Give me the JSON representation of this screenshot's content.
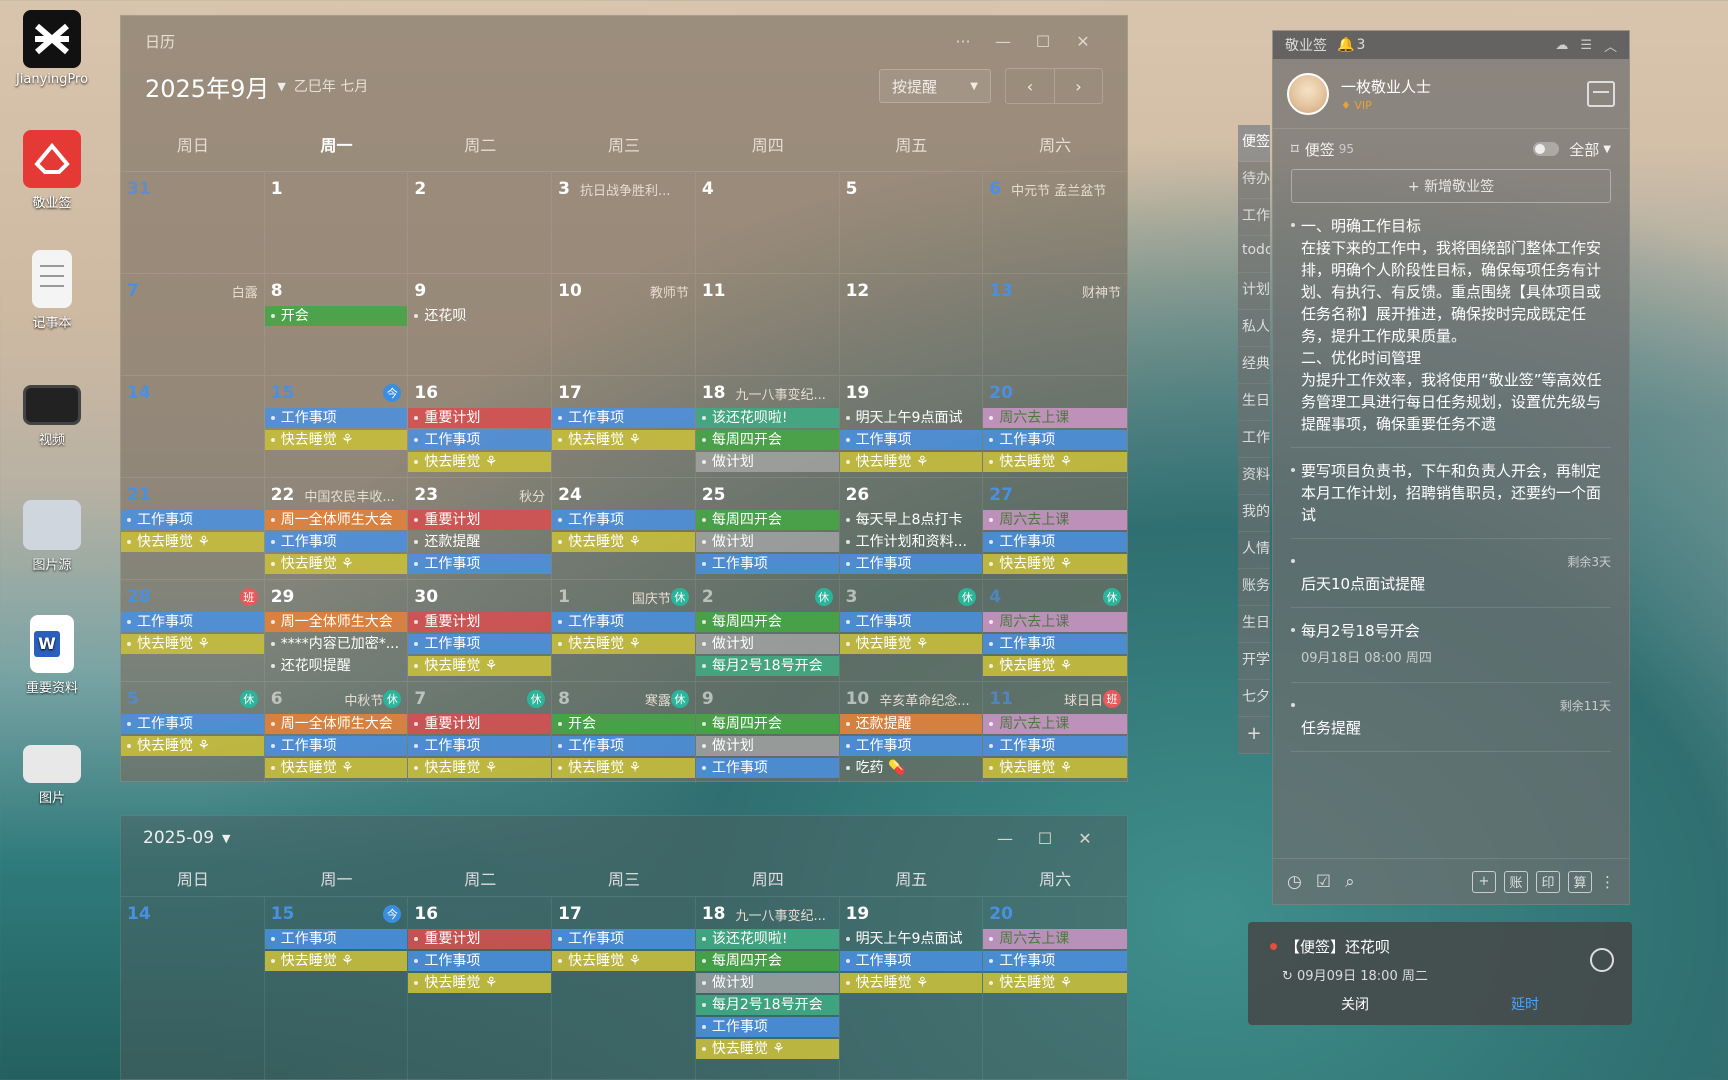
{
  "desktop": {
    "icons": [
      {
        "label": "JianyingPro"
      },
      {
        "label": "敬业签"
      },
      {
        "label": "记事本"
      },
      {
        "label": "视频"
      },
      {
        "label": "图片源"
      },
      {
        "label": "重要资料"
      },
      {
        "label": "图片"
      }
    ]
  },
  "calendar": {
    "window_title": "日历",
    "month_title": "2025年9月",
    "lunar_label": "乙巳年 七月",
    "mode_label": "按提醒",
    "weekdays": [
      "周日",
      "周一",
      "周二",
      "周三",
      "周四",
      "周五",
      "周六"
    ],
    "weeks": [
      [
        {
          "day": "31",
          "dim": true,
          "blue": true,
          "festival": "",
          "badge": "",
          "events": []
        },
        {
          "day": "1",
          "festival": "",
          "badge": "",
          "events": []
        },
        {
          "day": "2",
          "festival": "",
          "badge": "",
          "events": []
        },
        {
          "day": "3",
          "festival": "抗日战争胜利...",
          "badge": "",
          "events": []
        },
        {
          "day": "4",
          "festival": "",
          "badge": "",
          "events": []
        },
        {
          "day": "5",
          "festival": "",
          "badge": "",
          "events": []
        },
        {
          "day": "6",
          "blue": true,
          "festival": "中元节 孟兰盆节",
          "badge": "",
          "events": []
        }
      ],
      [
        {
          "day": "7",
          "blue": true,
          "festival": "白露",
          "right": true,
          "badge": "",
          "events": []
        },
        {
          "day": "8",
          "festival": "",
          "badge": "",
          "events": [
            {
              "text": "开会",
              "color": "green"
            }
          ]
        },
        {
          "day": "9",
          "festival": "",
          "badge": "",
          "events": [
            {
              "text": "还花呗",
              "color": "plain"
            }
          ]
        },
        {
          "day": "10",
          "festival": "教师节",
          "right": true,
          "badge": "",
          "events": []
        },
        {
          "day": "11",
          "festival": "",
          "badge": "",
          "events": []
        },
        {
          "day": "12",
          "festival": "",
          "badge": "",
          "events": []
        },
        {
          "day": "13",
          "blue": true,
          "festival": "财神节",
          "right": true,
          "badge": "",
          "events": []
        }
      ],
      [
        {
          "day": "14",
          "blue": true,
          "festival": "",
          "badge": "",
          "events": []
        },
        {
          "day": "15",
          "blue": true,
          "festival": "",
          "badge": "今",
          "badgeType": "today",
          "events": [
            {
              "text": "工作事项",
              "color": "blue"
            },
            {
              "text": "快去睡觉 ⚘",
              "color": "yellow"
            }
          ]
        },
        {
          "day": "16",
          "festival": "",
          "badge": "",
          "events": [
            {
              "text": "重要计划",
              "color": "red"
            },
            {
              "text": "工作事项",
              "color": "blue"
            },
            {
              "text": "快去睡觉 ⚘",
              "color": "yellow"
            }
          ]
        },
        {
          "day": "17",
          "festival": "",
          "badge": "",
          "events": [
            {
              "text": "工作事项",
              "color": "blue"
            },
            {
              "text": "快去睡觉 ⚘",
              "color": "yellow"
            }
          ]
        },
        {
          "day": "18",
          "festival": "九一八事变纪...",
          "badge": "",
          "events": [
            {
              "text": "该还花呗啦!",
              "color": "teal"
            },
            {
              "text": "每周四开会",
              "color": "green"
            },
            {
              "text": "做计划",
              "color": "gray"
            }
          ]
        },
        {
          "day": "19",
          "festival": "",
          "badge": "",
          "events": [
            {
              "text": "明天上午9点面试",
              "color": "plain"
            },
            {
              "text": "工作事项",
              "color": "blue"
            },
            {
              "text": "快去睡觉 ⚘",
              "color": "yellow"
            }
          ]
        },
        {
          "day": "20",
          "blue": true,
          "festival": "",
          "badge": "",
          "events": [
            {
              "text": "周六去上课",
              "color": "pink"
            },
            {
              "text": "工作事项",
              "color": "blue"
            },
            {
              "text": "快去睡觉 ⚘",
              "color": "yellow"
            }
          ]
        }
      ],
      [
        {
          "day": "21",
          "blue": true,
          "festival": "",
          "badge": "",
          "events": [
            {
              "text": "工作事项",
              "color": "blue"
            },
            {
              "text": "快去睡觉 ⚘",
              "color": "yellow"
            }
          ]
        },
        {
          "day": "22",
          "festival": "中国农民丰收...",
          "badge": "",
          "events": [
            {
              "text": "周一全体师生大会",
              "color": "orange"
            },
            {
              "text": "工作事项",
              "color": "blue"
            },
            {
              "text": "快去睡觉 ⚘",
              "color": "yellow"
            }
          ]
        },
        {
          "day": "23",
          "festival": "秋分",
          "right": true,
          "badge": "",
          "events": [
            {
              "text": "重要计划",
              "color": "red"
            },
            {
              "text": "还款提醒",
              "color": "plain"
            },
            {
              "text": "工作事项",
              "color": "blue"
            }
          ]
        },
        {
          "day": "24",
          "festival": "",
          "badge": "",
          "events": [
            {
              "text": "工作事项",
              "color": "blue"
            },
            {
              "text": "快去睡觉 ⚘",
              "color": "yellow"
            }
          ]
        },
        {
          "day": "25",
          "festival": "",
          "badge": "",
          "events": [
            {
              "text": "每周四开会",
              "color": "green"
            },
            {
              "text": "做计划",
              "color": "gray"
            },
            {
              "text": "工作事项",
              "color": "blue"
            }
          ]
        },
        {
          "day": "26",
          "festival": "",
          "badge": "",
          "events": [
            {
              "text": "每天早上8点打卡",
              "color": "plain"
            },
            {
              "text": "工作计划和资料...",
              "color": "plain"
            },
            {
              "text": "工作事项",
              "color": "blue"
            }
          ]
        },
        {
          "day": "27",
          "blue": true,
          "festival": "",
          "badge": "",
          "events": [
            {
              "text": "周六去上课",
              "color": "pink"
            },
            {
              "text": "工作事项",
              "color": "blue"
            },
            {
              "text": "快去睡觉 ⚘",
              "color": "yellow"
            }
          ]
        }
      ],
      [
        {
          "day": "28",
          "blue": true,
          "festival": "",
          "badge": "班",
          "badgeType": "work",
          "events": [
            {
              "text": "工作事项",
              "color": "blue"
            },
            {
              "text": "快去睡觉 ⚘",
              "color": "yellow"
            }
          ]
        },
        {
          "day": "29",
          "festival": "",
          "badge": "",
          "events": [
            {
              "text": "周一全体师生大会",
              "color": "orange"
            },
            {
              "text": "****内容已加密*...",
              "color": "plain"
            },
            {
              "text": "还花呗提醒",
              "color": "plain"
            }
          ]
        },
        {
          "day": "30",
          "festival": "",
          "badge": "",
          "events": [
            {
              "text": "重要计划",
              "color": "red"
            },
            {
              "text": "工作事项",
              "color": "blue"
            },
            {
              "text": "快去睡觉 ⚘",
              "color": "yellow"
            }
          ]
        },
        {
          "day": "1",
          "dim": true,
          "festival": "国庆节",
          "right": true,
          "badge": "休",
          "badgeType": "rest",
          "events": [
            {
              "text": "工作事项",
              "color": "blue"
            },
            {
              "text": "快去睡觉 ⚘",
              "color": "yellow"
            }
          ]
        },
        {
          "day": "2",
          "dim": true,
          "festival": "",
          "badge": "休",
          "badgeType": "rest",
          "events": [
            {
              "text": "每周四开会",
              "color": "green"
            },
            {
              "text": "做计划",
              "color": "gray"
            },
            {
              "text": "每月2号18号开会",
              "color": "teal"
            }
          ]
        },
        {
          "day": "3",
          "dim": true,
          "festival": "",
          "badge": "休",
          "badgeType": "rest",
          "events": [
            {
              "text": "工作事项",
              "color": "blue"
            },
            {
              "text": "快去睡觉 ⚘",
              "color": "yellow"
            }
          ]
        },
        {
          "day": "4",
          "dim": true,
          "blue": true,
          "festival": "",
          "badge": "休",
          "badgeType": "rest",
          "events": [
            {
              "text": "周六去上课",
              "color": "pink"
            },
            {
              "text": "工作事项",
              "color": "blue"
            },
            {
              "text": "快去睡觉 ⚘",
              "color": "yellow"
            }
          ]
        }
      ],
      [
        {
          "day": "5",
          "dim": true,
          "blue": true,
          "festival": "",
          "badge": "休",
          "badgeType": "rest",
          "events": [
            {
              "text": "工作事项",
              "color": "blue"
            },
            {
              "text": "快去睡觉 ⚘",
              "color": "yellow"
            }
          ]
        },
        {
          "day": "6",
          "dim": true,
          "festival": "中秋节",
          "right": true,
          "badge": "休",
          "badgeType": "rest",
          "events": [
            {
              "text": "周一全体师生大会",
              "color": "orange"
            },
            {
              "text": "工作事项",
              "color": "blue"
            },
            {
              "text": "快去睡觉 ⚘",
              "color": "yellow"
            }
          ]
        },
        {
          "day": "7",
          "dim": true,
          "festival": "",
          "badge": "休",
          "badgeType": "rest",
          "events": [
            {
              "text": "重要计划",
              "color": "red"
            },
            {
              "text": "工作事项",
              "color": "blue"
            },
            {
              "text": "快去睡觉 ⚘",
              "color": "yellow"
            }
          ]
        },
        {
          "day": "8",
          "dim": true,
          "festival": "寒露",
          "right": true,
          "badge": "休",
          "badgeType": "rest",
          "events": [
            {
              "text": "开会",
              "color": "green"
            },
            {
              "text": "工作事项",
              "color": "blue"
            },
            {
              "text": "快去睡觉 ⚘",
              "color": "yellow"
            }
          ]
        },
        {
          "day": "9",
          "dim": true,
          "festival": "",
          "badge": "",
          "events": [
            {
              "text": "每周四开会",
              "color": "green"
            },
            {
              "text": "做计划",
              "color": "gray"
            },
            {
              "text": "工作事项",
              "color": "blue"
            }
          ]
        },
        {
          "day": "10",
          "dim": true,
          "festival": "辛亥革命纪念...",
          "badge": "",
          "events": [
            {
              "text": "还款提醒",
              "color": "orange"
            },
            {
              "text": "工作事项",
              "color": "blue"
            },
            {
              "text": "吃药 💊",
              "color": "plain"
            }
          ]
        },
        {
          "day": "11",
          "dim": true,
          "blue": true,
          "festival": "球日日",
          "right": true,
          "badge": "班",
          "badgeType": "work",
          "events": [
            {
              "text": "周六去上课",
              "color": "pink"
            },
            {
              "text": "工作事项",
              "color": "blue"
            },
            {
              "text": "快去睡觉 ⚘",
              "color": "yellow"
            }
          ]
        }
      ]
    ]
  },
  "calendar2": {
    "title": "2025-09",
    "weekdays": [
      "周日",
      "周一",
      "周二",
      "周三",
      "周四",
      "周五",
      "周六"
    ],
    "week": [
      {
        "day": "14",
        "blue": true,
        "festival": "",
        "badge": "",
        "events": []
      },
      {
        "day": "15",
        "blue": true,
        "festival": "",
        "badge": "今",
        "badgeType": "today",
        "events": [
          {
            "text": "工作事项",
            "color": "blue"
          },
          {
            "text": "快去睡觉 ⚘",
            "color": "yellow"
          }
        ]
      },
      {
        "day": "16",
        "festival": "",
        "badge": "",
        "events": [
          {
            "text": "重要计划",
            "color": "red"
          },
          {
            "text": "工作事项",
            "color": "blue"
          },
          {
            "text": "快去睡觉 ⚘",
            "color": "yellow"
          }
        ]
      },
      {
        "day": "17",
        "festival": "",
        "badge": "",
        "events": [
          {
            "text": "工作事项",
            "color": "blue"
          },
          {
            "text": "快去睡觉 ⚘",
            "color": "yellow"
          }
        ]
      },
      {
        "day": "18",
        "festival": "九一八事变纪...",
        "badge": "",
        "events": [
          {
            "text": "该还花呗啦!",
            "color": "teal"
          },
          {
            "text": "每周四开会",
            "color": "green"
          },
          {
            "text": "做计划",
            "color": "gray"
          },
          {
            "text": "每月2号18号开会",
            "color": "teal"
          },
          {
            "text": "工作事项",
            "color": "blue"
          },
          {
            "text": "快去睡觉 ⚘",
            "color": "yellow"
          }
        ]
      },
      {
        "day": "19",
        "festival": "",
        "badge": "",
        "events": [
          {
            "text": "明天上午9点面试",
            "color": "plain"
          },
          {
            "text": "工作事项",
            "color": "blue"
          },
          {
            "text": "快去睡觉 ⚘",
            "color": "yellow"
          }
        ]
      },
      {
        "day": "20",
        "blue": true,
        "festival": "",
        "badge": "",
        "events": [
          {
            "text": "周六去上课",
            "color": "pink"
          },
          {
            "text": "工作事项",
            "color": "blue"
          },
          {
            "text": "快去睡觉 ⚘",
            "color": "yellow"
          }
        ]
      }
    ]
  },
  "notes": {
    "app_title": "敬业签",
    "bell_count": "3",
    "user_name": "一枚敬业人士",
    "vip_label": "VIP",
    "section_label": "便签",
    "section_count": "95",
    "filter_label": "全部",
    "add_label": "+ 新增敬业签",
    "side_tabs": [
      "便签",
      "待办",
      "工作",
      "todo",
      "计划",
      "私人",
      "经典",
      "生日",
      "工作",
      "资料",
      "我的",
      "人情",
      "账务",
      "生日",
      "开学",
      "七夕"
    ],
    "items": [
      {
        "text": "一、明确工作目标\n在接下来的工作中，我将围绕部门整体工作安排，明确个人阶段性目标，确保每项任务有计划、有执行、有反馈。重点围绕【具体项目或任务名称】展开推进，确保按时完成既定任务，提升工作成果质量。\n二、优化时间管理\n为提升工作效率，我将使用“敬业签”等高效任务管理工具进行每日任务规划，设置优先级与提醒事项，确保重要任务不遗",
        "meta": "",
        "remain": ""
      },
      {
        "text": "要写项目负责书，下午和负责人开会，再制定本月工作计划，招聘销售职员，还要约一个面试",
        "meta": "",
        "remain": ""
      },
      {
        "text": "后天10点面试提醒",
        "meta": "",
        "remain": "剩余3天"
      },
      {
        "text": "每月2号18号开会",
        "meta": "09月18日 08:00 周四",
        "remain": ""
      },
      {
        "text": "任务提醒",
        "meta": "",
        "remain": "剩余11天"
      }
    ],
    "footer_buttons": [
      "账",
      "印",
      "算"
    ]
  },
  "popup": {
    "title": "【便签】还花呗",
    "time": "09月09日 18:00 周二",
    "close_label": "关闭",
    "delay_label": "延时"
  }
}
